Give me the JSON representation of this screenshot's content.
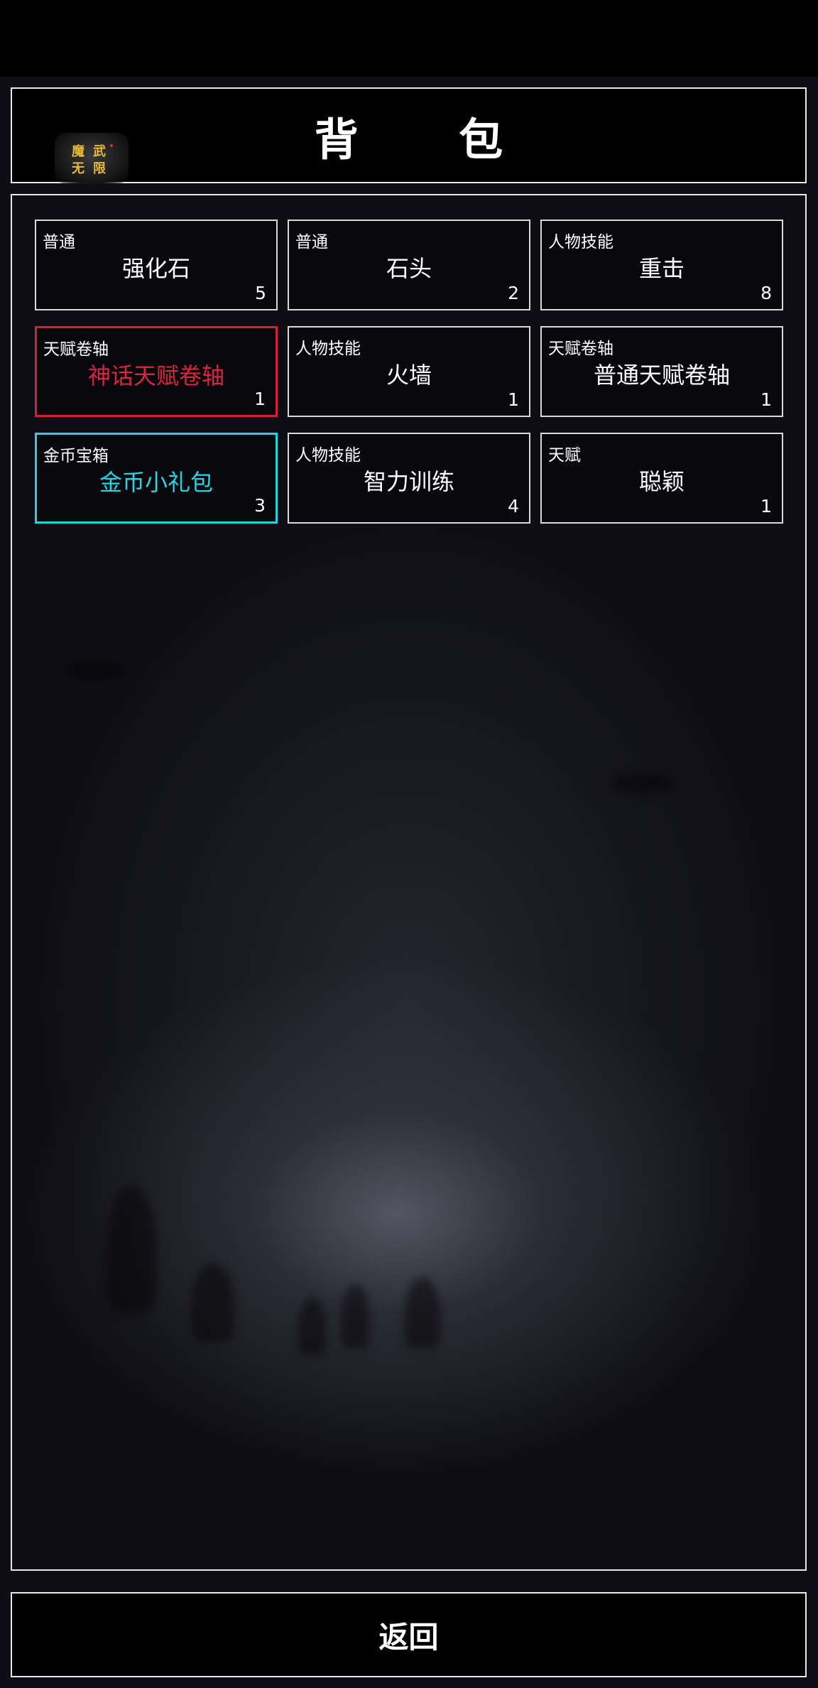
{
  "header": {
    "title": "背 包",
    "logo_text": "魔武无限"
  },
  "inventory": {
    "items": [
      {
        "category": "普通",
        "name": "强化石",
        "count": "5",
        "rarity": "normal"
      },
      {
        "category": "普通",
        "name": "石头",
        "count": "2",
        "rarity": "normal"
      },
      {
        "category": "人物技能",
        "name": "重击",
        "count": "8",
        "rarity": "normal"
      },
      {
        "category": "天赋卷轴",
        "name": "神话天赋卷轴",
        "count": "1",
        "rarity": "mythic"
      },
      {
        "category": "人物技能",
        "name": "火墙",
        "count": "1",
        "rarity": "normal"
      },
      {
        "category": "天赋卷轴",
        "name": "普通天赋卷轴",
        "count": "1",
        "rarity": "normal"
      },
      {
        "category": "金币宝箱",
        "name": "金币小礼包",
        "count": "3",
        "rarity": "gold"
      },
      {
        "category": "人物技能",
        "name": "智力训练",
        "count": "4",
        "rarity": "normal"
      },
      {
        "category": "天赋",
        "name": "聪颖",
        "count": "1",
        "rarity": "normal"
      }
    ]
  },
  "footer": {
    "back_label": "返回"
  },
  "colors": {
    "border": "#e8e8e8",
    "mythic": "#d9253f",
    "gold_chest": "#23d6e4",
    "background": "#000000"
  }
}
